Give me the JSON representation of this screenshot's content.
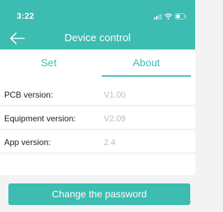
{
  "status_bar": {
    "time": "3:22"
  },
  "header": {
    "title": "Device control"
  },
  "tabs": [
    {
      "label": "Set",
      "active": false
    },
    {
      "label": "About",
      "active": true
    }
  ],
  "info": {
    "rows": [
      {
        "label": "PCB version:",
        "value": "V1.00"
      },
      {
        "label": "Equipment version:",
        "value": "V2.09"
      },
      {
        "label": "App version:",
        "value": "2.4"
      }
    ]
  },
  "actions": {
    "change_password_label": "Change the password"
  },
  "colors": {
    "accent": "#3dbcb1",
    "value_text": "#bdbdbd",
    "background": "#f3f3f3"
  },
  "icons": {
    "back": "arrow-left-icon",
    "signal": "signal-icon",
    "wifi": "wifi-icon",
    "battery": "battery-icon"
  }
}
